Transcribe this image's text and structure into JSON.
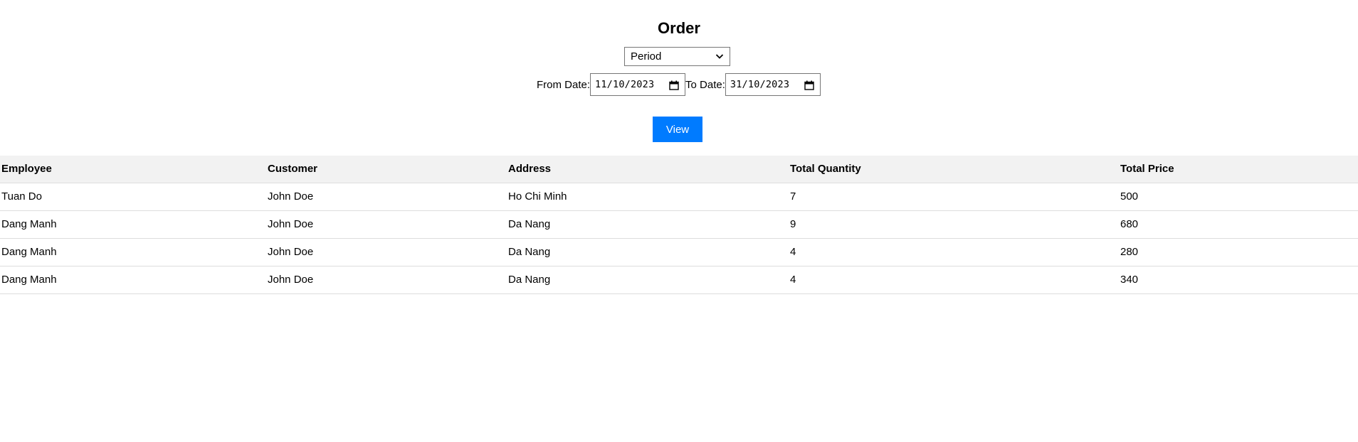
{
  "page": {
    "title": "Order"
  },
  "filter": {
    "select_value": "Period",
    "from_label": "From Date:",
    "from_value": "11/10/2023",
    "to_label": "To Date:",
    "to_value": "31/10/2023",
    "view_label": "View"
  },
  "table": {
    "headers": [
      "Employee",
      "Customer",
      "Address",
      "Total Quantity",
      "Total Price"
    ],
    "rows": [
      [
        "Tuan Do",
        "John Doe",
        "Ho Chi Minh",
        "7",
        "500"
      ],
      [
        "Dang Manh",
        "John Doe",
        "Da Nang",
        "9",
        "680"
      ],
      [
        "Dang Manh",
        "John Doe",
        "Da Nang",
        "4",
        "280"
      ],
      [
        "Dang Manh",
        "John Doe",
        "Da Nang",
        "4",
        "340"
      ]
    ]
  },
  "icons": {
    "select_arrow": "chevron-down-icon",
    "date_picker": "calendar-icon"
  },
  "colors": {
    "primary_button": "#007bff",
    "table_header_bg": "#f2f2f2"
  }
}
